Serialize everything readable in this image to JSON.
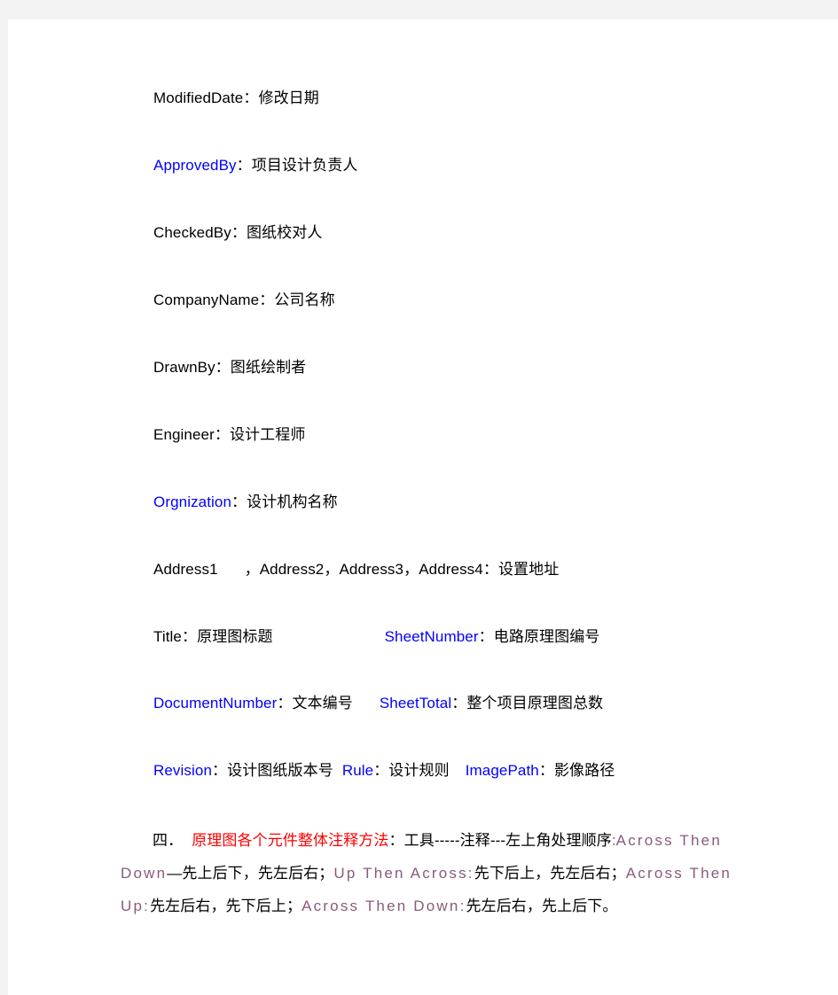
{
  "document": {
    "fields": [
      {
        "key": "ModifiedDate",
        "key_color": "black",
        "separator": "：",
        "value": "修改日期"
      },
      {
        "key": "ApprovedBy",
        "key_color": "blue",
        "separator": "：",
        "value": "项目设计负责人"
      },
      {
        "key": "CheckedBy",
        "key_color": "black",
        "separator": "：",
        "value": "图纸校对人"
      },
      {
        "key": "CompanyName",
        "key_color": "black",
        "separator": "：",
        "value": "公司名称"
      },
      {
        "key": "DrawnBy",
        "key_color": "black",
        "separator": "：",
        "value": "图纸绘制者"
      },
      {
        "key": "Engineer",
        "key_color": "black",
        "separator": "：",
        "value": "设计工程师"
      },
      {
        "key": "Orgnization",
        "key_color": "blue",
        "separator": "：",
        "value": "设计机构名称"
      }
    ],
    "address_line": {
      "key1": "Address1",
      "key2": "Address2",
      "key3": "Address3",
      "key4": "Address4",
      "comma": "，",
      "separator": "：",
      "value": "设置地址"
    },
    "title_line": {
      "key_left": "Title",
      "sep_left": "：",
      "value_left": "原理图标题",
      "key_right": "SheetNumber",
      "sep_right": "：",
      "value_right": "电路原理图编号"
    },
    "docnumber_line": {
      "key_left": "DocumentNumber",
      "sep_left": "：",
      "value_left": "文本编号",
      "key_right": "SheetTotal",
      "sep_right": "：",
      "value_right": "整个项目原理图总数"
    },
    "revision_line": {
      "key1": "Revision",
      "sep1": "：",
      "value1": "设计图纸版本号",
      "key2": "Rule",
      "sep2": "：",
      "value2": "设计规则",
      "key3": "ImagePath",
      "sep3": "：",
      "value3": "影像路径"
    },
    "section": {
      "number": "四．",
      "heading": "原理图各个元件整体注释方法",
      "heading_sep": "：",
      "path": "工具-----注释---左上角处理顺序",
      "order_sep1": ":",
      "term1": "Across Then Down",
      "term1_dash": "—",
      "desc1a": "先上后下，先左后右；",
      "term2": "Up Then Across:",
      "desc2": "先下后上，先左后右；",
      "term3": "Across Then Up:",
      "desc3": "先左后右，先下后上；",
      "term4": "Across Then Down:",
      "desc4": "先左后右，先上后下。"
    }
  },
  "colors": {
    "keyword_blue": "#0000ff",
    "heading_red": "#ff0000",
    "term_mauve": "#8a5a7a",
    "body_black": "#000000",
    "page_white": "#ffffff",
    "canvas_gray": "#f3f3f4"
  }
}
